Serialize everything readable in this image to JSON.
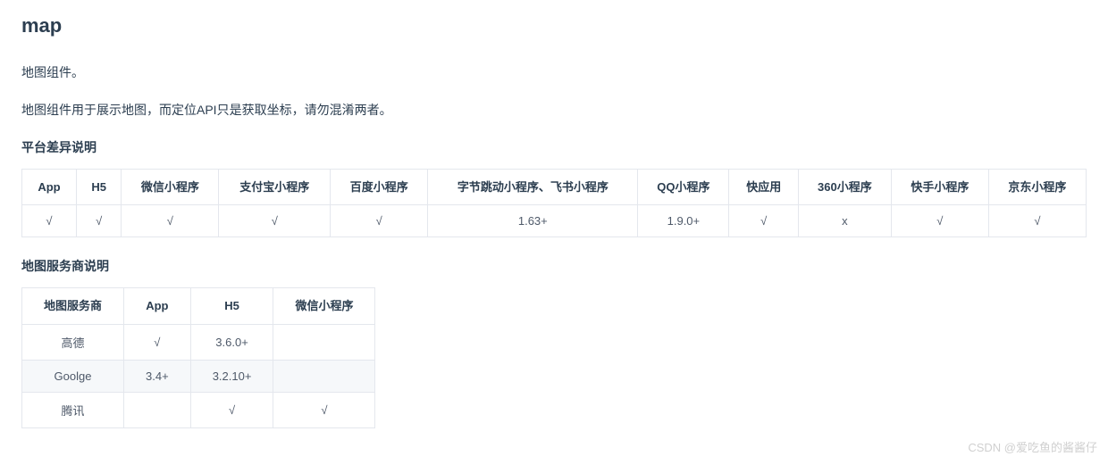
{
  "title": "map",
  "intro1": "地图组件。",
  "intro2": "地图组件用于展示地图，而定位API只是获取坐标，请勿混淆两者。",
  "section1_title": "平台差异说明",
  "table1": {
    "headers": [
      "App",
      "H5",
      "微信小程序",
      "支付宝小程序",
      "百度小程序",
      "字节跳动小程序、飞书小程序",
      "QQ小程序",
      "快应用",
      "360小程序",
      "快手小程序",
      "京东小程序"
    ],
    "row": [
      "√",
      "√",
      "√",
      "√",
      "√",
      "1.63+",
      "1.9.0+",
      "√",
      "x",
      "√",
      "√"
    ]
  },
  "section2_title": "地图服务商说明",
  "table2": {
    "headers": [
      "地图服务商",
      "App",
      "H5",
      "微信小程序"
    ],
    "rows": [
      [
        "高德",
        "√",
        "3.6.0+",
        ""
      ],
      [
        "Goolge",
        "3.4+",
        "3.2.10+",
        ""
      ],
      [
        "腾讯",
        "",
        "√",
        "√"
      ]
    ]
  },
  "watermark": "CSDN @爱吃鱼的酱酱仔"
}
